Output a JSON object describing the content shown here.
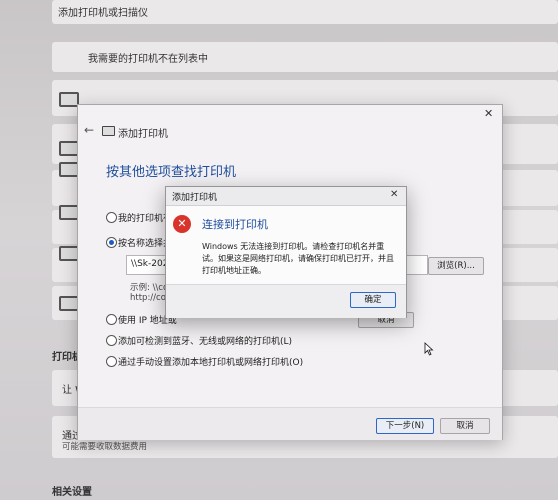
{
  "background": {
    "header": "添加打印机或扫描仪",
    "not_listed": "我需要的打印机不在列表中",
    "printers_section": "打印机",
    "let_row_prefix": "让 W",
    "metered_row_prefix": "通过",
    "metered_note": "可能需要收取数据费用",
    "related_settings": "相关设置"
  },
  "wizard": {
    "title": "添加打印机",
    "heading": "按其他选项查找打印机",
    "options": [
      {
        "label": "我的打印机有",
        "selected": false
      },
      {
        "label": "按名称选择共",
        "selected": true
      },
      {
        "label": "使用 IP 地址或",
        "selected": false
      },
      {
        "label": "添加可检测到蓝牙、无线或网络的打印机(L)",
        "selected": false
      },
      {
        "label": "通过手动设置添加本地打印机或网络打印机(O)",
        "selected": false
      }
    ],
    "name_value": "\\\\Sk-202",
    "example_label": "示例: \\\\co",
    "example_url": "http://co",
    "browse_button": "浏览(R)...",
    "next_button": "下一步(N)",
    "cancel_button": "取消",
    "inner_cancel_button": "取消"
  },
  "error_dialog": {
    "title": "添加打印机",
    "heading": "连接到打印机",
    "message_lines": [
      "Windows 无法连接到打印机。请检查打印机名并重",
      "试。如果这是网络打印机，请确保打印机已打开，并且",
      "打印机地址正确。"
    ],
    "ok_button": "确定"
  },
  "colors": {
    "accent": "#1e5bc6",
    "heading_blue": "#1f4e9c",
    "error_red": "#d9342c"
  }
}
